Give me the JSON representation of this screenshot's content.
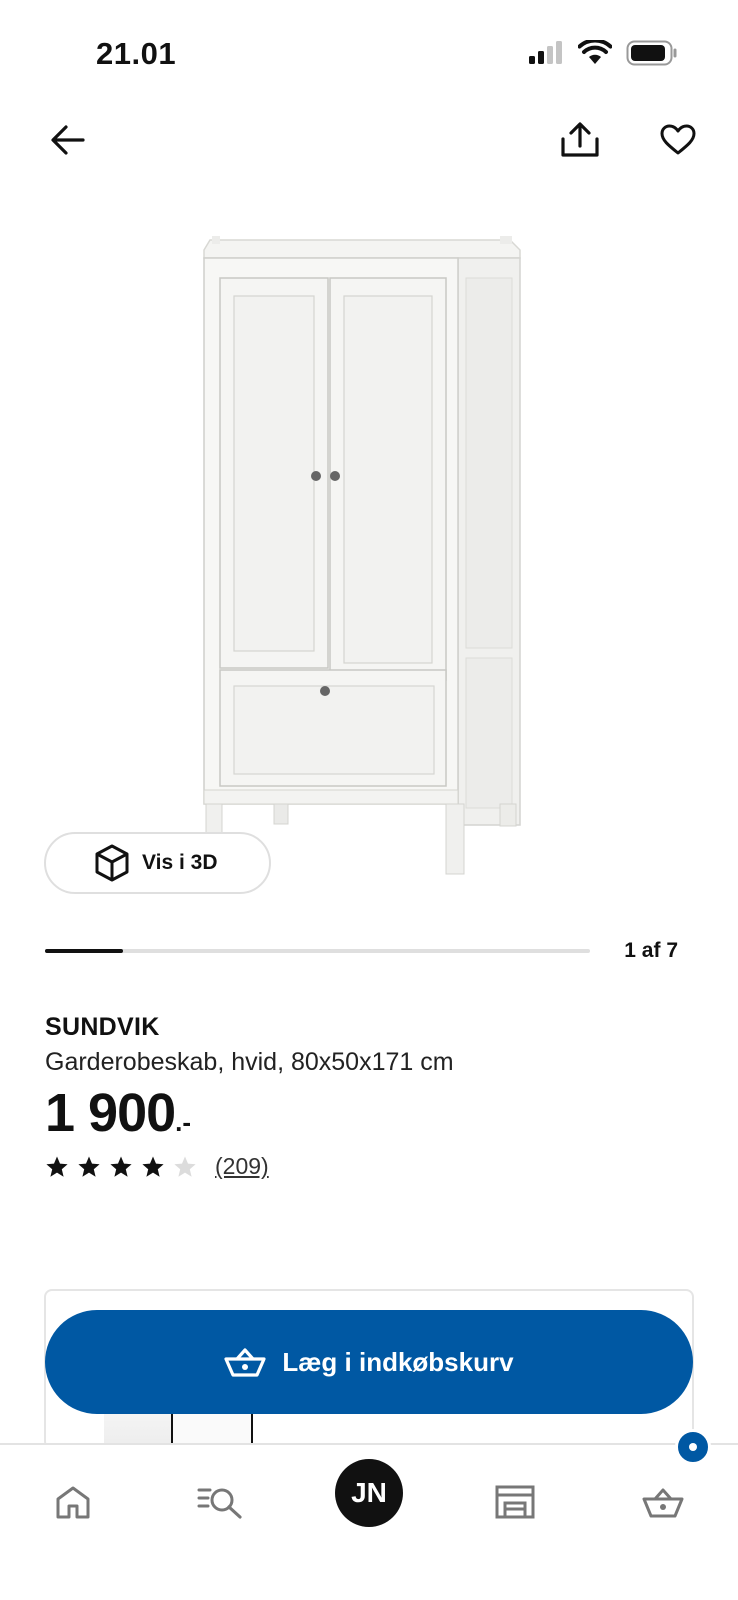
{
  "status_bar": {
    "time": "21.01",
    "icons": [
      "cellular-signal-icon",
      "wifi-icon",
      "battery-icon"
    ]
  },
  "nav": {
    "icons": [
      "back-arrow-icon",
      "share-icon",
      "heart-icon"
    ]
  },
  "gallery": {
    "view_3d_label": "Vis i 3D",
    "counter": "1 af 7",
    "current_image": 1,
    "total_images": 7
  },
  "product": {
    "name": "SUNDVIK",
    "description": "Garderobeskab, hvid, 80x50x171 cm",
    "price": "1 900",
    "price_suffix": ".-",
    "rating": 4,
    "rating_max": 5,
    "review_count": "(209)"
  },
  "cart": {
    "add_label": "Læg i indkøbskurv"
  },
  "bottom_nav": {
    "items": [
      "home-icon",
      "search-icon",
      "profile-avatar",
      "store-icon",
      "cart-icon"
    ],
    "avatar_initials": "JN",
    "cart_has_items": true
  },
  "colors": {
    "brand_blue": "#0058a3",
    "text": "#111111",
    "border": "#dfdfdf"
  }
}
